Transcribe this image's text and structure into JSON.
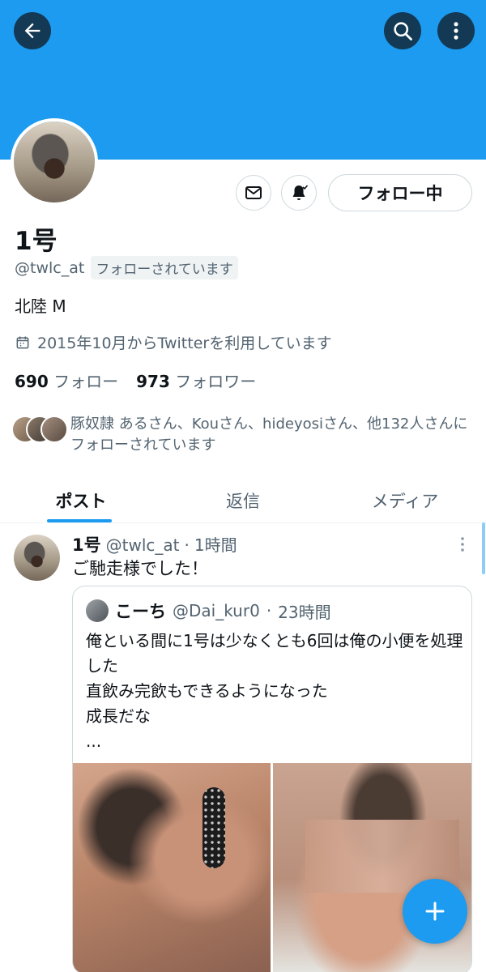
{
  "profile": {
    "name": "1号",
    "handle": "@twlc_at",
    "follows_you_label": "フォローされています",
    "bio": "北陸 M",
    "joined": "2015年10月からTwitterを利用しています",
    "following_count": "690",
    "following_label": "フォロー",
    "followers_count": "973",
    "followers_label": "フォロワー",
    "mutuals_text": "豚奴隷 あるさん、Kouさん、hideyosiさん、他132人さんにフォローされています",
    "follow_button_label": "フォロー中"
  },
  "icons": {
    "back": "back-arrow-icon",
    "search": "search-icon",
    "more": "more-vertical-icon",
    "mail": "mail-icon",
    "bell": "bell-subscribed-icon",
    "calendar": "calendar-icon",
    "compose": "plus-icon"
  },
  "tabs": [
    {
      "label": "ポスト",
      "active": true
    },
    {
      "label": "返信",
      "active": false
    },
    {
      "label": "メディア",
      "active": false
    }
  ],
  "post": {
    "author": "1号",
    "handle": "@twlc_at",
    "time": "1時間",
    "text": "ご馳走様でした！",
    "quote": {
      "author": "こーち",
      "handle": "@Dai_kur0",
      "time": "23時間",
      "lines": [
        "俺といる間に1号は少なくとも6回は俺の小便を処理した",
        "直飲み完飲もできるようになった",
        "成長だな",
        "..."
      ]
    }
  },
  "colors": {
    "accent": "#1d9bf0",
    "text_primary": "#0f1419",
    "text_secondary": "#536471",
    "border": "#cfd9de"
  }
}
